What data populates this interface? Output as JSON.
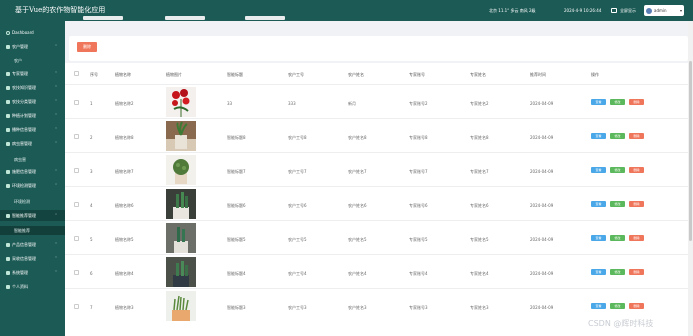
{
  "header": {
    "title": "基于Vue的农作物智能化应用",
    "weather": "北京 11.1° 多云 南风 2级",
    "datetime": "2024-4-9 10:26:44",
    "fullscreen_label": "全屏显示",
    "user_name": "admin"
  },
  "sidebar": {
    "items": [
      {
        "label": "Dashboard"
      },
      {
        "label": "农户管理"
      },
      {
        "label": "农户"
      },
      {
        "label": "专家管理"
      },
      {
        "label": "农技知识管理"
      },
      {
        "label": "农技分类管理"
      },
      {
        "label": "种植计划管理"
      },
      {
        "label": "播种信息管理"
      },
      {
        "label": "病虫害管理"
      },
      {
        "label": "病虫害"
      },
      {
        "label": "施肥信息管理"
      },
      {
        "label": "环境检测管理"
      },
      {
        "label": "环境检测"
      },
      {
        "label": "智能推荐管理"
      },
      {
        "label": "智能推荐"
      },
      {
        "label": "产品信息管理"
      },
      {
        "label": "采收信息管理"
      },
      {
        "label": "系统管理"
      },
      {
        "label": "个人资料"
      }
    ]
  },
  "toolbar": {
    "delete_label": "删除"
  },
  "table": {
    "columns": [
      "序号",
      "植物名称",
      "植物图片",
      "智能标题",
      "农户工号",
      "农户姓名",
      "专家账号",
      "专家姓名",
      "推荐时间",
      "操作"
    ],
    "rows": [
      {
        "index": "1",
        "name": "植物名称2",
        "title": "33",
        "farmer_id": "333",
        "farmer_name": "新月",
        "expert_acct": "专家账号2",
        "expert_name": "专家姓名2",
        "time": "2024-04-09"
      },
      {
        "index": "2",
        "name": "植物名称8",
        "title": "智能标题8",
        "farmer_id": "农户工号8",
        "farmer_name": "农户姓名8",
        "expert_acct": "专家账号8",
        "expert_name": "专家姓名8",
        "time": "2024-04-09"
      },
      {
        "index": "3",
        "name": "植物名称7",
        "title": "智能标题7",
        "farmer_id": "农户工号7",
        "farmer_name": "农户姓名7",
        "expert_acct": "专家账号7",
        "expert_name": "专家姓名7",
        "time": "2024-04-09"
      },
      {
        "index": "4",
        "name": "植物名称6",
        "title": "智能标题6",
        "farmer_id": "农户工号6",
        "farmer_name": "农户姓名6",
        "expert_acct": "专家账号6",
        "expert_name": "专家姓名6",
        "time": "2024-04-09"
      },
      {
        "index": "5",
        "name": "植物名称5",
        "title": "智能标题5",
        "farmer_id": "农户工号5",
        "farmer_name": "农户姓名5",
        "expert_acct": "专家账号5",
        "expert_name": "专家姓名5",
        "time": "2024-04-09"
      },
      {
        "index": "6",
        "name": "植物名称4",
        "title": "智能标题4",
        "farmer_id": "农户工号4",
        "farmer_name": "农户姓名4",
        "expert_acct": "专家账号4",
        "expert_name": "专家姓名4",
        "time": "2024-04-09"
      },
      {
        "index": "7",
        "name": "植物名称3",
        "title": "智能标题3",
        "farmer_id": "农户工号3",
        "farmer_name": "农户姓名3",
        "expert_acct": "专家账号3",
        "expert_name": "专家姓名3",
        "time": "2024-04-09"
      }
    ],
    "actions": {
      "view": "查看",
      "edit": "修改",
      "delete": "删除"
    }
  },
  "watermark": "CSDN @辉时科技",
  "colors": {
    "sidebar": "#1c5a55",
    "view": "#4aa8e8",
    "edit": "#5cb85c",
    "delete": "#f0765b"
  }
}
